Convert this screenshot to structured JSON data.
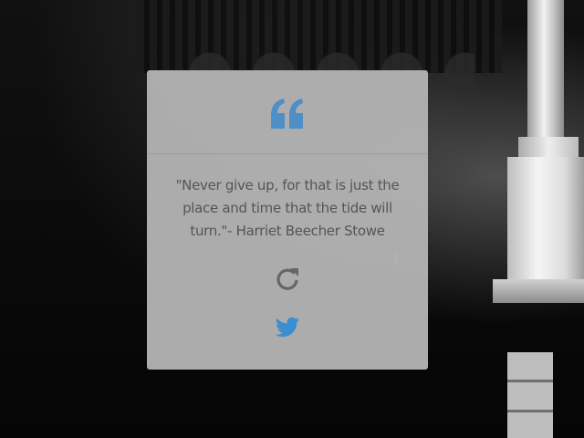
{
  "background": {
    "description_icon": "dark-building-photo"
  },
  "quote_box": {
    "quote_icon": "quote-icon",
    "quote_text": "\"Never give up, for that is just the place and time that the tide will turn.\"- Harriet Beecher Stowe",
    "refresh_icon": "refresh-icon",
    "twitter_icon": "twitter-icon",
    "accent_color": "#4f8fc7",
    "icon_gray": "#666666",
    "card_color": "#b2b2b2"
  }
}
